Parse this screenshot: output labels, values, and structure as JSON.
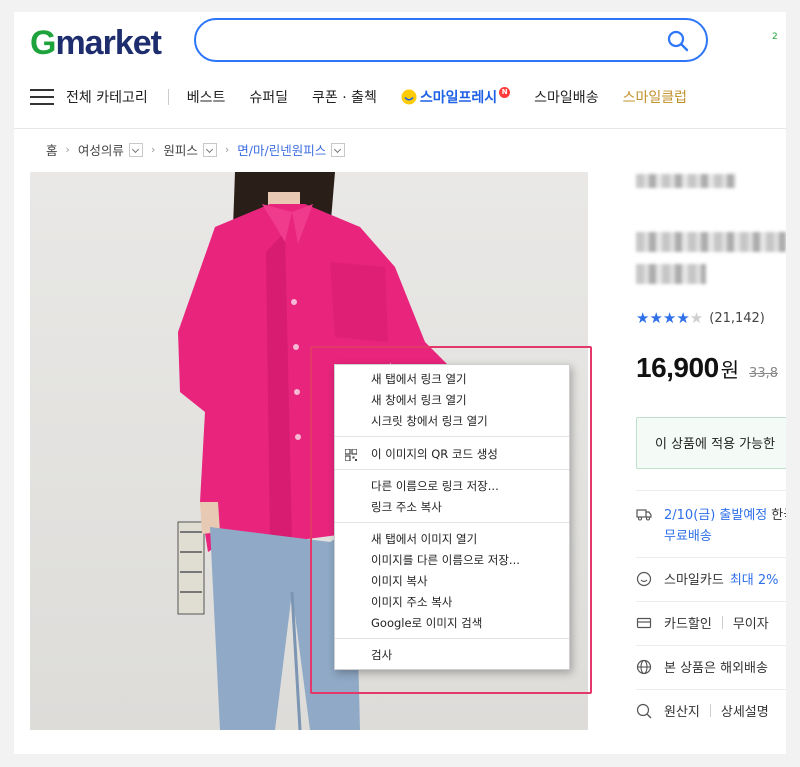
{
  "header": {
    "logo_g": "G",
    "logo_rest": "market",
    "search_value": "",
    "edge_badge": "2"
  },
  "nav": {
    "all_categories": "전체 카테고리",
    "items": [
      "베스트",
      "슈퍼딜",
      "쿠폰 · 출첵"
    ],
    "smile_fresh": "스마일프레시",
    "smile_fresh_badge": "N",
    "smile_delivery": "스마일배송",
    "smile_club": "스마일클럽"
  },
  "breadcrumb": {
    "home": "홈",
    "level1": "여성의류",
    "level2": "원피스",
    "level3": "면/마/린넨원피스"
  },
  "product": {
    "rating_stars": 4,
    "rating_count": "(21,142)",
    "price": "16,900",
    "price_unit": "원",
    "original_price": "33,8",
    "coupon_text": "이 상품에 적용 가능한",
    "shipping_date": "2/10(금) 출발예정",
    "shipping_extra": "한국",
    "shipping_free": "무료배송",
    "smile_card": "스마일카드",
    "smile_card_benefit": "최대 2%",
    "card_discount": "카드할인",
    "card_installment": "무이자",
    "overseas": "본 상품은 해외배송",
    "origin": "원산지",
    "detail": "상세설명"
  },
  "context_menu": {
    "items": [
      "새 탭에서 링크 열기",
      "새 창에서 링크 열기",
      "시크릿 창에서 링크 열기",
      "이 이미지의 QR 코드 생성",
      "다른 이름으로 링크 저장...",
      "링크 주소 복사",
      "새 탭에서 이미지 열기",
      "이미지를 다른 이름으로 저장...",
      "이미지 복사",
      "이미지 주소 복사",
      "Google로 이미지 검색",
      "검사"
    ]
  },
  "colors": {
    "accent_blue": "#2c76f7",
    "logo_green": "#1ea23c",
    "logo_navy": "#1e2d6e",
    "highlight_red": "#e4386a",
    "shirt_pink": "#e8247c",
    "jeans_blue": "#8fa9c6"
  }
}
